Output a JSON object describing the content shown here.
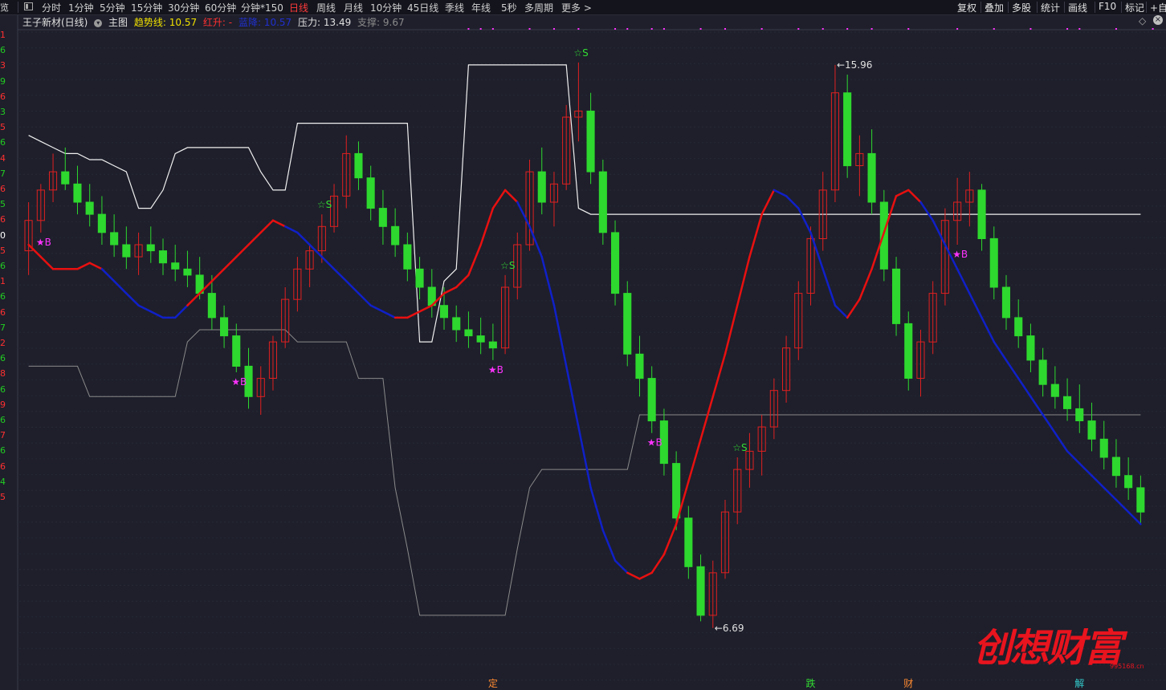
{
  "toolbar": {
    "left_icon_label": "览",
    "periods": [
      {
        "label": "分时",
        "active": false
      },
      {
        "label": "1分钟",
        "active": false
      },
      {
        "label": "5分钟",
        "active": false
      },
      {
        "label": "15分钟",
        "active": false
      },
      {
        "label": "30分钟",
        "active": false
      },
      {
        "label": "60分钟",
        "active": false
      },
      {
        "label": "分钟*150",
        "active": false
      },
      {
        "label": "日线",
        "active": true
      },
      {
        "label": "周线",
        "active": false
      },
      {
        "label": "月线",
        "active": false
      },
      {
        "label": "10分钟",
        "active": false
      },
      {
        "label": "45日线",
        "active": false
      },
      {
        "label": "季线",
        "active": false
      },
      {
        "label": "年线",
        "active": false
      },
      {
        "label": "5秒",
        "active": false
      },
      {
        "label": "多周期",
        "active": false
      },
      {
        "label": "更多 >",
        "active": false
      }
    ],
    "right": [
      "复权",
      "叠加",
      "多股",
      "统计",
      "画线",
      "F10",
      "标记",
      "+自"
    ]
  },
  "legend": {
    "stock": "王子新材(日线)",
    "main_label": "主图",
    "trend_label": "趋势线: 10.57",
    "red_label": "红升: -",
    "blue_label": "蓝降: 10.57",
    "pressure_label": "压力: 13.49",
    "support_label": "支撑: 9.67"
  },
  "left_axis": {
    "labels": [
      "1",
      "6",
      "3",
      "9",
      "6",
      "3",
      "5",
      "6",
      "4",
      "7",
      "6",
      "5",
      "6",
      "0",
      "5",
      "6",
      "1",
      "6",
      "6",
      "7",
      "2",
      "6",
      "8",
      "6",
      "9",
      "6",
      "7",
      "6",
      "6",
      "4",
      "5"
    ],
    "colors": [
      "#ff3030",
      "#22cc22",
      "#888888",
      "#ffffff"
    ]
  },
  "colors": {
    "background": "#1e1f2b",
    "grid": "#262a36",
    "up": "#e02020",
    "down": "#2ed82e",
    "trend_up": "#e81010",
    "trend_down": "#1020c8",
    "pressure": "#f0f0f0",
    "support": "#8a8a8a",
    "buy": "#ff33ff",
    "sell": "#33dd33",
    "marker": "#ff33ff"
  },
  "chart_data": {
    "type": "candlestick",
    "title": "王子新材(日线)",
    "price_range": [
      6.0,
      16.5
    ],
    "ohlc": [
      [
        12.9,
        13.7,
        12.5,
        13.4
      ],
      [
        13.4,
        14.0,
        13.2,
        13.9
      ],
      [
        13.9,
        14.5,
        13.7,
        14.2
      ],
      [
        14.2,
        14.6,
        13.9,
        14.0
      ],
      [
        14.0,
        14.3,
        13.5,
        13.7
      ],
      [
        13.7,
        14.0,
        13.3,
        13.5
      ],
      [
        13.5,
        13.8,
        13.0,
        13.2
      ],
      [
        13.2,
        13.5,
        12.8,
        13.0
      ],
      [
        13.0,
        13.3,
        12.6,
        12.8
      ],
      [
        12.8,
        13.2,
        12.5,
        13.0
      ],
      [
        13.0,
        13.3,
        12.7,
        12.9
      ],
      [
        12.9,
        13.1,
        12.5,
        12.7
      ],
      [
        12.7,
        13.0,
        12.4,
        12.6
      ],
      [
        12.6,
        12.9,
        12.3,
        12.5
      ],
      [
        12.5,
        12.8,
        12.1,
        12.2
      ],
      [
        12.2,
        12.5,
        11.6,
        11.8
      ],
      [
        11.8,
        12.0,
        11.3,
        11.5
      ],
      [
        11.5,
        11.7,
        10.9,
        11.0
      ],
      [
        11.0,
        11.3,
        10.3,
        10.5
      ],
      [
        10.5,
        11.0,
        10.2,
        10.8
      ],
      [
        10.8,
        11.5,
        10.6,
        11.4
      ],
      [
        11.4,
        12.3,
        11.3,
        12.1
      ],
      [
        12.1,
        12.8,
        11.9,
        12.6
      ],
      [
        12.6,
        13.0,
        12.3,
        12.9
      ],
      [
        12.9,
        13.5,
        12.7,
        13.3
      ],
      [
        13.3,
        14.0,
        13.2,
        13.8
      ],
      [
        13.8,
        14.8,
        13.6,
        14.5
      ],
      [
        14.5,
        14.7,
        13.9,
        14.1
      ],
      [
        14.1,
        14.3,
        13.4,
        13.6
      ],
      [
        13.6,
        13.9,
        13.0,
        13.3
      ],
      [
        13.3,
        13.6,
        12.8,
        13.0
      ],
      [
        13.0,
        13.2,
        12.4,
        12.6
      ],
      [
        12.6,
        12.8,
        12.1,
        12.3
      ],
      [
        12.3,
        12.6,
        11.8,
        12.0
      ],
      [
        12.0,
        12.3,
        11.6,
        11.8
      ],
      [
        11.8,
        12.0,
        11.4,
        11.6
      ],
      [
        11.6,
        11.9,
        11.3,
        11.5
      ],
      [
        11.5,
        11.8,
        11.2,
        11.4
      ],
      [
        11.4,
        11.7,
        11.1,
        11.3
      ],
      [
        11.3,
        12.5,
        11.2,
        12.3
      ],
      [
        12.3,
        13.2,
        12.1,
        13.0
      ],
      [
        13.0,
        14.4,
        12.9,
        14.2
      ],
      [
        14.2,
        14.6,
        13.5,
        13.7
      ],
      [
        13.7,
        14.2,
        13.3,
        14.0
      ],
      [
        14.0,
        15.3,
        13.9,
        15.1
      ],
      [
        15.1,
        16.0,
        14.7,
        15.2
      ],
      [
        15.2,
        15.5,
        14.0,
        14.2
      ],
      [
        14.2,
        14.4,
        13.0,
        13.2
      ],
      [
        13.2,
        13.4,
        12.0,
        12.2
      ],
      [
        12.2,
        12.4,
        11.0,
        11.2
      ],
      [
        11.2,
        11.5,
        10.5,
        10.8
      ],
      [
        10.8,
        11.0,
        9.9,
        10.1
      ],
      [
        10.1,
        10.3,
        9.2,
        9.4
      ],
      [
        9.4,
        9.6,
        8.3,
        8.5
      ],
      [
        8.5,
        8.7,
        7.5,
        7.7
      ],
      [
        7.7,
        7.9,
        6.8,
        6.9
      ],
      [
        6.9,
        7.8,
        6.69,
        7.6
      ],
      [
        7.6,
        8.8,
        7.5,
        8.6
      ],
      [
        8.6,
        9.5,
        8.4,
        9.3
      ],
      [
        9.3,
        9.9,
        9.0,
        9.6
      ],
      [
        9.6,
        10.2,
        9.2,
        10.0
      ],
      [
        10.0,
        10.8,
        9.8,
        10.6
      ],
      [
        10.6,
        11.5,
        10.4,
        11.3
      ],
      [
        11.3,
        12.4,
        11.1,
        12.2
      ],
      [
        12.2,
        13.3,
        12.0,
        13.1
      ],
      [
        13.1,
        14.2,
        12.9,
        13.9
      ],
      [
        13.9,
        15.96,
        13.7,
        15.5
      ],
      [
        15.5,
        15.8,
        14.1,
        14.3
      ],
      [
        14.3,
        14.8,
        13.8,
        14.5
      ],
      [
        14.5,
        14.9,
        13.5,
        13.7
      ],
      [
        13.7,
        13.9,
        12.4,
        12.6
      ],
      [
        12.6,
        12.8,
        11.5,
        11.7
      ],
      [
        11.7,
        11.9,
        10.6,
        10.8
      ],
      [
        10.8,
        11.6,
        10.5,
        11.4
      ],
      [
        11.4,
        12.4,
        11.2,
        12.2
      ],
      [
        12.2,
        13.6,
        12.0,
        13.4
      ],
      [
        13.4,
        14.1,
        13.0,
        13.7
      ],
      [
        13.7,
        14.2,
        13.3,
        13.9
      ],
      [
        13.9,
        14.0,
        12.9,
        13.1
      ],
      [
        13.1,
        13.3,
        12.1,
        12.3
      ],
      [
        12.3,
        12.5,
        11.6,
        11.8
      ],
      [
        11.8,
        12.1,
        11.3,
        11.5
      ],
      [
        11.5,
        11.7,
        10.9,
        11.1
      ],
      [
        11.1,
        11.3,
        10.5,
        10.7
      ],
      [
        10.7,
        11.0,
        10.3,
        10.5
      ],
      [
        10.5,
        10.8,
        10.1,
        10.3
      ],
      [
        10.3,
        10.7,
        9.9,
        10.1
      ],
      [
        10.1,
        10.4,
        9.6,
        9.8
      ],
      [
        9.8,
        10.1,
        9.3,
        9.5
      ],
      [
        9.5,
        9.8,
        9.0,
        9.2
      ],
      [
        9.2,
        9.5,
        8.8,
        9.0
      ],
      [
        9.0,
        9.2,
        8.4,
        8.6
      ]
    ],
    "trend_line": [
      13.0,
      12.8,
      12.6,
      12.6,
      12.6,
      12.7,
      12.6,
      12.4,
      12.2,
      12.0,
      11.9,
      11.8,
      11.8,
      12.0,
      12.2,
      12.4,
      12.6,
      12.8,
      13.0,
      13.2,
      13.4,
      13.3,
      13.2,
      13.0,
      12.8,
      12.6,
      12.4,
      12.2,
      12.0,
      11.9,
      11.8,
      11.8,
      11.9,
      12.0,
      12.2,
      12.3,
      12.5,
      13.0,
      13.6,
      13.9,
      13.7,
      13.3,
      12.8,
      12.0,
      11.0,
      10.0,
      9.0,
      8.3,
      7.8,
      7.6,
      7.5,
      7.6,
      7.9,
      8.4,
      9.1,
      9.8,
      10.5,
      11.2,
      12.0,
      12.8,
      13.5,
      13.9,
      13.8,
      13.6,
      13.2,
      12.6,
      12.0,
      11.8,
      12.1,
      12.6,
      13.2,
      13.8,
      13.9,
      13.7,
      13.4,
      13.0,
      12.6,
      12.2,
      11.8,
      11.4,
      11.1,
      10.8,
      10.5,
      10.2,
      9.9,
      9.6,
      9.4,
      9.2,
      9.0,
      8.8,
      8.6,
      8.4
    ],
    "trend_up": [
      true,
      true,
      true,
      true,
      true,
      true,
      false,
      false,
      false,
      false,
      false,
      false,
      false,
      true,
      true,
      true,
      true,
      true,
      true,
      true,
      true,
      false,
      false,
      false,
      false,
      false,
      false,
      false,
      false,
      false,
      true,
      true,
      true,
      true,
      true,
      true,
      true,
      true,
      true,
      true,
      false,
      false,
      false,
      false,
      false,
      false,
      false,
      false,
      false,
      true,
      true,
      true,
      true,
      true,
      true,
      true,
      true,
      true,
      true,
      true,
      true,
      false,
      false,
      false,
      false,
      false,
      false,
      true,
      true,
      true,
      true,
      true,
      true,
      false,
      false,
      false,
      false,
      false,
      false,
      false,
      false,
      false,
      false,
      false,
      false,
      false,
      false,
      false,
      false,
      false,
      false,
      false
    ],
    "pressure_line": [
      14.8,
      14.7,
      14.6,
      14.5,
      14.5,
      14.4,
      14.4,
      14.3,
      14.2,
      13.6,
      13.6,
      13.9,
      14.5,
      14.6,
      14.6,
      14.6,
      14.6,
      14.6,
      14.6,
      14.2,
      13.9,
      13.9,
      15.0,
      15.0,
      15.0,
      15.0,
      15.0,
      15.0,
      15.0,
      15.0,
      15.0,
      15.0,
      11.4,
      11.4,
      12.4,
      12.6,
      15.96,
      15.96,
      15.96,
      15.96,
      15.96,
      15.96,
      15.96,
      15.96,
      15.96,
      13.6,
      13.5,
      13.5,
      13.5,
      13.5,
      13.5,
      13.5,
      13.5,
      13.5,
      13.5,
      13.5,
      13.5,
      13.5,
      13.5,
      13.5,
      13.5,
      13.5,
      13.5,
      13.5,
      13.5,
      13.5,
      13.5,
      13.5,
      13.5,
      13.5,
      13.5,
      13.5,
      13.5,
      13.5,
      13.5,
      13.5,
      13.5,
      13.5,
      13.5,
      13.5,
      13.5,
      13.5,
      13.5,
      13.5,
      13.5,
      13.5,
      13.5,
      13.5,
      13.5,
      13.5,
      13.5,
      13.5
    ],
    "support_line": [
      11.0,
      11.0,
      11.0,
      11.0,
      11.0,
      10.5,
      10.5,
      10.5,
      10.5,
      10.5,
      10.5,
      10.5,
      10.5,
      11.4,
      11.6,
      11.6,
      11.6,
      11.6,
      11.6,
      11.6,
      11.6,
      11.6,
      11.4,
      11.4,
      11.4,
      11.4,
      11.4,
      10.8,
      10.8,
      10.8,
      9.0,
      8.0,
      6.9,
      6.9,
      6.9,
      6.9,
      6.9,
      6.9,
      6.9,
      6.9,
      8.0,
      9.0,
      9.3,
      9.3,
      9.3,
      9.3,
      9.3,
      9.3,
      9.3,
      9.3,
      10.2,
      10.2,
      10.2,
      10.2,
      10.2,
      10.2,
      10.2,
      10.2,
      10.2,
      10.2,
      10.2,
      10.2,
      10.2,
      10.2,
      10.2,
      10.2,
      10.2,
      10.2,
      10.2,
      10.2,
      10.2,
      10.2,
      10.2,
      10.2,
      10.2,
      10.2,
      10.2,
      10.2,
      10.2,
      10.2,
      10.2,
      10.2,
      10.2,
      10.2,
      10.2,
      10.2,
      10.2,
      10.2,
      10.2,
      10.2,
      10.2,
      10.2
    ],
    "buy_signals": [
      1,
      17,
      38,
      51,
      76
    ],
    "buy_label": "★B",
    "sell_signals": [
      24,
      39,
      45,
      58
    ],
    "sell_label": "☆S",
    "annotations": [
      {
        "label": "15.96",
        "index": 66,
        "value": 15.96
      },
      {
        "label": "6.69",
        "index": 56,
        "value": 6.69
      }
    ],
    "bottom_tags": [
      {
        "label": "定",
        "index": 38,
        "color": "#ff8a30"
      },
      {
        "label": "跌",
        "index": 64,
        "color": "#33dd33"
      },
      {
        "label": "财",
        "index": 72,
        "color": "#ff8a30"
      },
      {
        "label": "解",
        "index": 86,
        "color": "#33cccc"
      }
    ],
    "top_markers": [
      36,
      37,
      38,
      41,
      43,
      45,
      48,
      49,
      51,
      52,
      55,
      57,
      60,
      63,
      65,
      67,
      69,
      72,
      76,
      79,
      82,
      85,
      86,
      89,
      92,
      94,
      96
    ],
    "xlabel": "",
    "ylabel": ""
  },
  "watermark": {
    "text": "创想财富",
    "url": "995168.cn"
  }
}
